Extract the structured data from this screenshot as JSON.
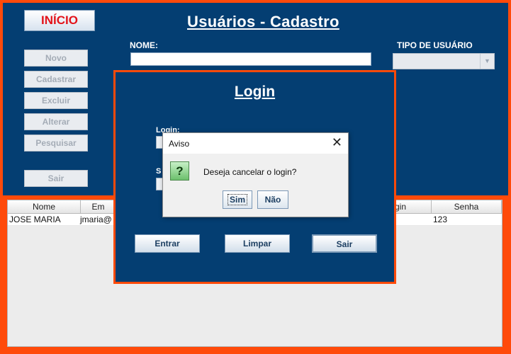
{
  "window": {
    "inicio_label": "INÍCIO",
    "title": "Usuários - Cadastro",
    "nome_label": "NOME:",
    "nome_value": "",
    "tipo_label": "TIPO DE USUÁRIO",
    "tipo_value": ""
  },
  "sidebar": {
    "buttons": [
      {
        "label": "Novo"
      },
      {
        "label": "Cadastrar"
      },
      {
        "label": "Excluir"
      },
      {
        "label": "Alterar"
      },
      {
        "label": "Pesquisar"
      },
      {
        "label": "Sair"
      }
    ]
  },
  "table": {
    "headers": [
      "Nome",
      "Em",
      "gin",
      "Senha"
    ],
    "rows": [
      {
        "nome": "JOSE MARIA",
        "email": "jmaria@",
        "senha": "123"
      }
    ]
  },
  "login": {
    "title": "Login",
    "login_label": "Login:",
    "senha_label_partial": "S",
    "buttons": {
      "entrar": "Entrar",
      "limpar": "Limpar",
      "sair": "Sair"
    }
  },
  "dialog": {
    "title": "Aviso",
    "close": "✕",
    "icon": "question-icon",
    "icon_glyph": "?",
    "message": "Deseja cancelar o login?",
    "yes": "Sim",
    "no": "Não"
  },
  "colors": {
    "accent_border": "#ff4a0a",
    "panel_blue": "#043e72"
  }
}
